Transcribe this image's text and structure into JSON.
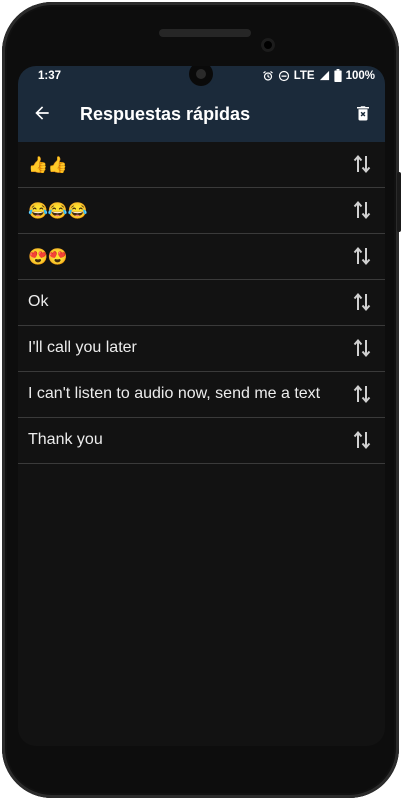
{
  "status_bar": {
    "time": "1:37",
    "network": "LTE",
    "battery": "100%"
  },
  "app_bar": {
    "title": "Respuestas rápidas",
    "back_icon": "arrow-back-icon",
    "action_icon": "delete-icon"
  },
  "replies": [
    {
      "text": "👍👍"
    },
    {
      "text": "😂😂😂"
    },
    {
      "text": "😍😍"
    },
    {
      "text": "Ok"
    },
    {
      "text": "I'll call you later"
    },
    {
      "text": "I can't listen to audio now, send me a text"
    },
    {
      "text": "Thank you"
    }
  ],
  "colors": {
    "app_bar": "#1b2a3a",
    "background": "#121212",
    "divider": "#3a3a3a",
    "text": "#ececec"
  }
}
